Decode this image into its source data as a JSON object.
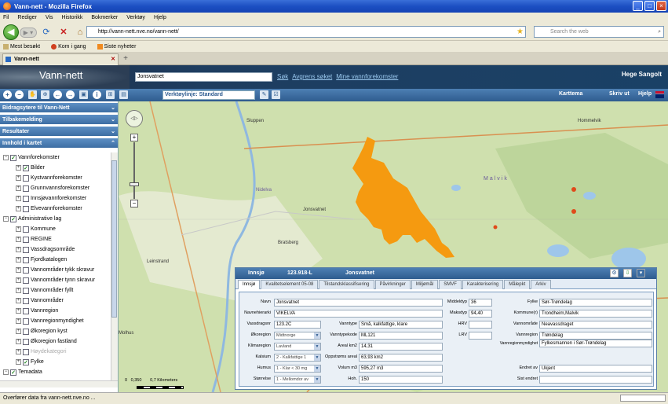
{
  "window": {
    "title": "Vann-nett - Mozilla Firefox"
  },
  "menu": [
    "Fil",
    "Rediger",
    "Vis",
    "Historikk",
    "Bokmerker",
    "Verktøy",
    "Hjelp"
  ],
  "browser": {
    "url": "http://vann-nett.nve.no/vann-nett/",
    "search_placeholder": "Search the web"
  },
  "bookmarks": [
    "Mest besøkt",
    "Kom i gang",
    "Siste nyheter"
  ],
  "tab": {
    "label": "Vann-nett"
  },
  "app": {
    "title": "Vann-nett",
    "search_value": "Jonsvatnet",
    "links": [
      "Søk",
      "Avgrens søket",
      "Mine vannforekomster"
    ],
    "user": "Hege Sangolt",
    "toolbar_select": "Verktøylinje: Standard",
    "toolbar_right": [
      "Karttema",
      "Skriv ut",
      "Hjelp"
    ]
  },
  "sidebar": {
    "sections": [
      "Bidragsytere til Vann-Nett",
      "Tilbakemelding",
      "Resultater",
      "Innhold i kartet"
    ],
    "tree": [
      {
        "label": "Vannforekomster",
        "level": 0,
        "checked": true
      },
      {
        "label": "Bilder",
        "level": 1,
        "checked": true
      },
      {
        "label": "Kystvannforekomster",
        "level": 1,
        "checked": false
      },
      {
        "label": "Grunnvannsforekomster",
        "level": 1,
        "checked": false
      },
      {
        "label": "Innsjøvannforekomster",
        "level": 1,
        "checked": false
      },
      {
        "label": "Elvevannforekomster",
        "level": 1,
        "checked": false
      },
      {
        "label": "Administrative lag",
        "level": 0,
        "checked": true
      },
      {
        "label": "Kommune",
        "level": 1,
        "checked": false
      },
      {
        "label": "REGINE",
        "level": 1,
        "checked": false
      },
      {
        "label": "Vassdragsområde",
        "level": 1,
        "checked": false
      },
      {
        "label": "Fjordkatalogen",
        "level": 1,
        "checked": false
      },
      {
        "label": "Vannområder tykk skravur",
        "level": 1,
        "checked": false
      },
      {
        "label": "Vannområder tynn skravur",
        "level": 1,
        "checked": false
      },
      {
        "label": "Vannområder fyllt",
        "level": 1,
        "checked": false
      },
      {
        "label": "Vannområder",
        "level": 1,
        "checked": false
      },
      {
        "label": "Vannregion",
        "level": 1,
        "checked": false
      },
      {
        "label": "Vannregionmyndighet",
        "level": 1,
        "checked": false
      },
      {
        "label": "Økoregion kyst",
        "level": 1,
        "checked": false
      },
      {
        "label": "Økoregion fastland",
        "level": 1,
        "checked": false
      },
      {
        "label": "Høydekategori",
        "level": 1,
        "checked": false,
        "disabled": true
      },
      {
        "label": "Fylke",
        "level": 1,
        "checked": true
      },
      {
        "label": "Temadata",
        "level": 0,
        "checked": true
      }
    ]
  },
  "map": {
    "places": [
      "Sluppen",
      "Jonsvatnet",
      "Bratsberg",
      "Leinstrand",
      "Nidelva",
      "Malvik",
      "Hommelvik",
      "Molhus"
    ],
    "scale_text": "0   0,350       0,7 Kilometers"
  },
  "panel": {
    "header": [
      "Innsjø",
      "123.918-L",
      "Jonsvatnet"
    ],
    "tabs": [
      "Innsjø",
      "Kvalitetselement 05-08",
      "Tilstandsklassifisering",
      "Påvirkninger",
      "Miljømål",
      "SMVF",
      "Karakterisering",
      "Målepkt",
      "Arkiv"
    ],
    "fields": {
      "navn": {
        "label": "Navn",
        "value": "Jonsvatnet"
      },
      "navnehierarki": {
        "label": "Navnehierarki",
        "value": "VIKELVA"
      },
      "vassdragsnr": {
        "label": "Vassdragsnr",
        "value": "123.2C"
      },
      "okoregion": {
        "label": "Økoregion",
        "value": "Midtnorge"
      },
      "klimaregion": {
        "label": "Klimaregion",
        "value": "Lavland"
      },
      "kalsium": {
        "label": "Kalsium",
        "value": "2 - Kalkfattige 1"
      },
      "humus": {
        "label": "Humus",
        "value": "1 - Klar < 30 mg"
      },
      "storrelse": {
        "label": "Størrelse",
        "value": "1 - Mellomdor av"
      },
      "vanntype": {
        "label": "Vanntype",
        "value": "Små, kalkfattige, klare"
      },
      "vanntypekode": {
        "label": "Vanntypekode",
        "value": "ML121"
      },
      "areal": {
        "label": "Areal km2",
        "value": "14,31"
      },
      "opp_areal": {
        "label": "Oppstrøms areal",
        "value": "63,93 km2"
      },
      "volum": {
        "label": "Volum m3",
        "value": "595,27 m3"
      },
      "hoh": {
        "label": "Hoh.",
        "value": "150"
      },
      "middeldyp": {
        "label": "Middeldyp",
        "value": "36"
      },
      "maksdyp": {
        "label": "Maksdyp",
        "value": "94,40"
      },
      "hrv": {
        "label": "HRV",
        "value": ""
      },
      "lrv": {
        "label": "LRV",
        "value": ""
      },
      "fylke": {
        "label": "Fylke",
        "value": "Sør-Trøndelag"
      },
      "kommune": {
        "label": "Kommune(r)",
        "value": "Trondheim,Malvik"
      },
      "vannomrade": {
        "label": "Vannområde",
        "value": "Neavassdraget"
      },
      "vannregion": {
        "label": "Vannregion",
        "value": "Trøndelag"
      },
      "vannregionmyndighet": {
        "label": "Vannregionmyndighet",
        "value": "Fylkesmannen i Sør-Trøndelag"
      },
      "endret_av": {
        "label": "Endret av",
        "value": "Ukjent"
      },
      "sist_endret": {
        "label": "Sist endret",
        "value": ""
      }
    }
  },
  "status": {
    "text": "Overfører data fra vann-nett.nve.no ..."
  },
  "colors": {
    "lake": "#f59a10",
    "banner": "#1e3d60",
    "toolbar": "#3d6ea3",
    "map_base": "#c9dba8"
  }
}
